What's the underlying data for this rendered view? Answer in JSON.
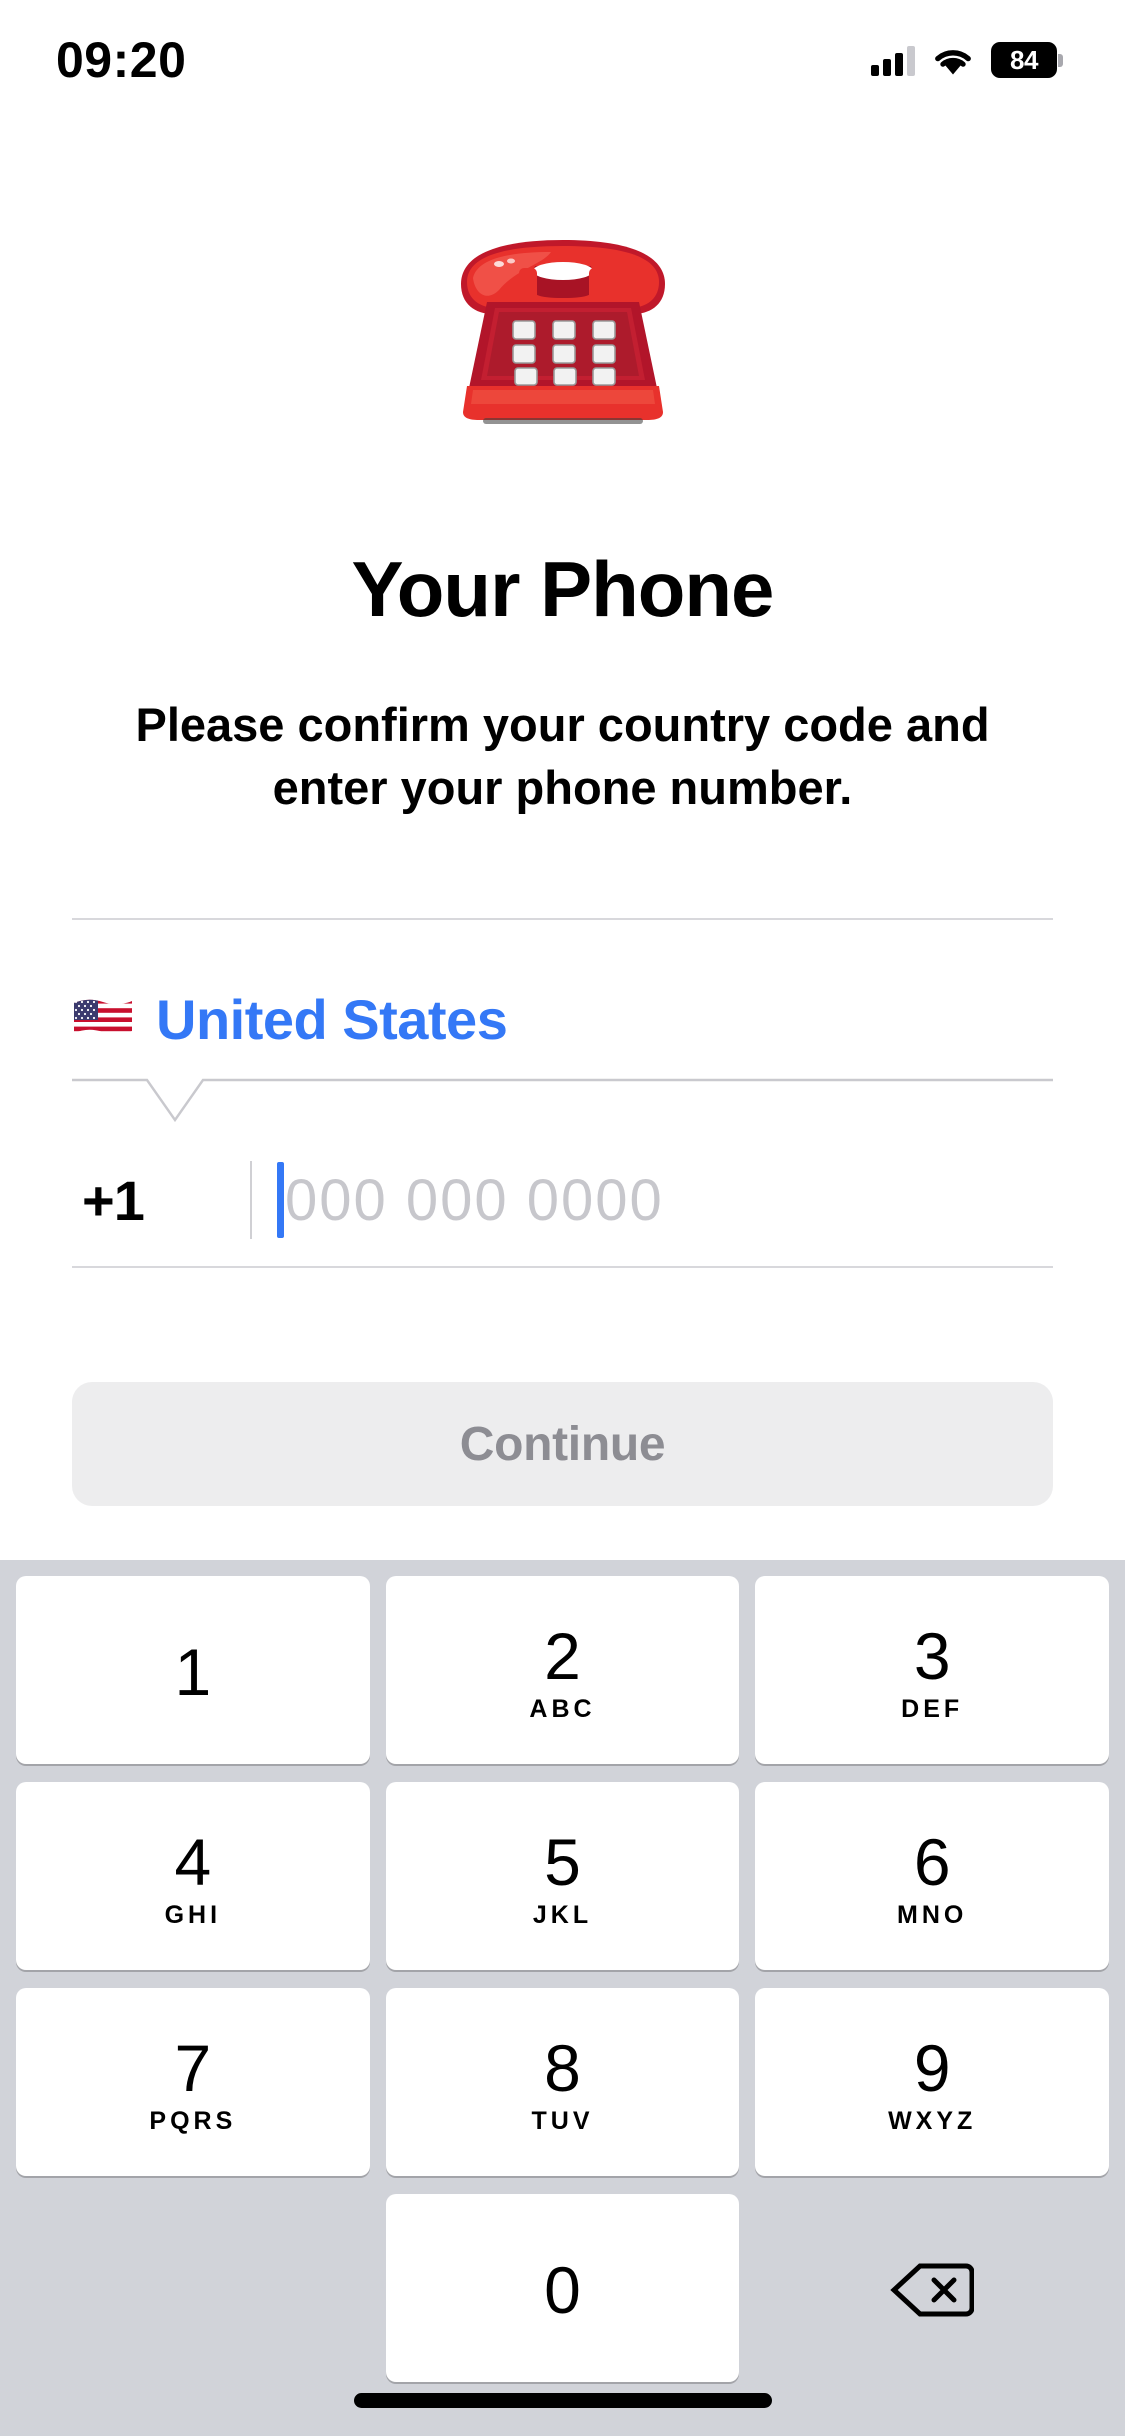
{
  "status_bar": {
    "time": "09:20",
    "battery_level": "84",
    "signal_icon": "cellular-signal-icon",
    "wifi_icon": "wifi-icon",
    "battery_icon": "battery-icon"
  },
  "hero": {
    "icon": "telephone-emoji",
    "emoji": "☎️"
  },
  "page": {
    "title": "Your Phone",
    "subtitle": "Please confirm your country code and enter your phone number."
  },
  "country": {
    "flag_icon": "united-states-flag-emoji",
    "flag": "🇺🇸",
    "name": "United States",
    "dial_code": "+1"
  },
  "phone_input": {
    "placeholder": "000 000 0000",
    "value": ""
  },
  "actions": {
    "continue_label": "Continue",
    "continue_enabled": false
  },
  "colors": {
    "accent_blue": "#3478F6",
    "placeholder_gray": "#c7c7cc",
    "button_disabled_bg": "#EDEDEE",
    "button_disabled_text": "#8d8d93",
    "keyboard_bg": "#D1D3D9",
    "key_bg": "#FFFFFF",
    "divider": "#d8d8dc"
  },
  "keypad": {
    "rows": [
      [
        {
          "digit": "1",
          "letters": "",
          "name": "key-1"
        },
        {
          "digit": "2",
          "letters": "ABC",
          "name": "key-2"
        },
        {
          "digit": "3",
          "letters": "DEF",
          "name": "key-3"
        }
      ],
      [
        {
          "digit": "4",
          "letters": "GHI",
          "name": "key-4"
        },
        {
          "digit": "5",
          "letters": "JKL",
          "name": "key-5"
        },
        {
          "digit": "6",
          "letters": "MNO",
          "name": "key-6"
        }
      ],
      [
        {
          "digit": "7",
          "letters": "PQRS",
          "name": "key-7"
        },
        {
          "digit": "8",
          "letters": "TUV",
          "name": "key-8"
        },
        {
          "digit": "9",
          "letters": "WXYZ",
          "name": "key-9"
        }
      ],
      [
        {
          "digit": "",
          "letters": "",
          "name": "key-blank"
        },
        {
          "digit": "0",
          "letters": "",
          "name": "key-0"
        },
        {
          "digit": "",
          "letters": "",
          "name": "key-delete",
          "icon": "backspace-icon"
        }
      ]
    ]
  }
}
